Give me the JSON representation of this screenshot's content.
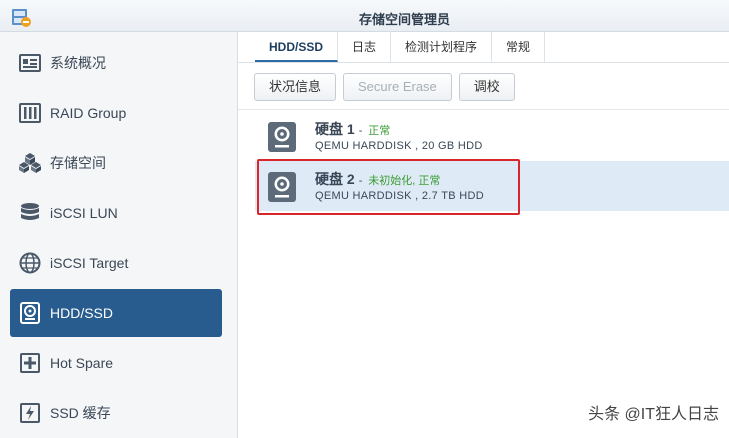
{
  "window": {
    "title": "存储空间管理员"
  },
  "sidebar": {
    "items": [
      {
        "label": "系统概况",
        "icon": "overview-icon",
        "active": false
      },
      {
        "label": "RAID Group",
        "icon": "raid-icon",
        "active": false
      },
      {
        "label": "存储空间",
        "icon": "cubes-icon",
        "active": false
      },
      {
        "label": "iSCSI LUN",
        "icon": "database-icon",
        "active": false
      },
      {
        "label": "iSCSI Target",
        "icon": "globe-icon",
        "active": false
      },
      {
        "label": "HDD/SSD",
        "icon": "hdd-icon",
        "active": true
      },
      {
        "label": "Hot Spare",
        "icon": "plus-box-icon",
        "active": false
      },
      {
        "label": "SSD 缓存",
        "icon": "lightning-box-icon",
        "active": false
      }
    ]
  },
  "tabs": [
    {
      "label": "HDD/SSD",
      "active": true
    },
    {
      "label": "日志",
      "active": false
    },
    {
      "label": "检测计划程序",
      "active": false
    },
    {
      "label": "常规",
      "active": false
    }
  ],
  "toolbar": {
    "status_info": "状况信息",
    "secure_erase": "Secure Erase",
    "calibrate": "调校"
  },
  "disks": [
    {
      "name": "硬盘 1",
      "dash": "-",
      "status": "正常",
      "desc": "QEMU HARDDISK , 20 GB HDD",
      "selected": false
    },
    {
      "name": "硬盘 2",
      "dash": "-",
      "status": "未初始化, 正常",
      "desc": "QEMU HARDDISK , 2.7 TB HDD",
      "selected": true
    }
  ],
  "watermark": "头条 @IT狂人日志",
  "colors": {
    "accent": "#285b8e",
    "status_ok": "#3c9b33",
    "highlight": "#d9262b",
    "selected_row": "#deebf7"
  }
}
